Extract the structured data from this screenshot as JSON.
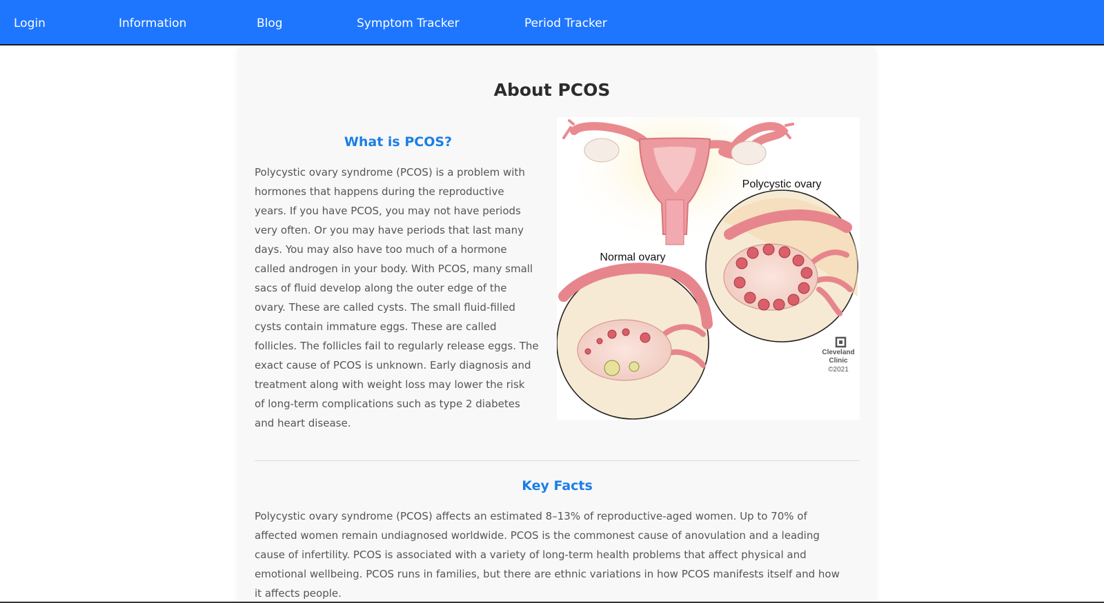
{
  "nav": {
    "items": [
      "Login",
      "Information",
      "Blog",
      "Symptom Tracker",
      "Period Tracker"
    ]
  },
  "page": {
    "title": "About PCOS"
  },
  "what_is": {
    "heading": "What is PCOS?",
    "lines": [
      "Polycystic ovary syndrome (PCOS) is a problem with",
      "hormones that happens during the reproductive",
      "years. If you have PCOS, you may not have periods",
      "very often. Or you may have periods that last many",
      "days. You may also have too much of a hormone",
      "called androgen in your body. With PCOS, many small",
      "sacs of fluid develop along the outer edge of the",
      "ovary. These are called cysts. The small fluid-filled",
      "cysts contain immature eggs. These are called",
      "follicles. The follicles fail to regularly release eggs. The",
      "exact cause of PCOS is unknown. Early diagnosis and",
      "treatment along with weight loss may lower the risk",
      "of long-term complications such as type 2 diabetes",
      "and heart disease."
    ]
  },
  "illustration": {
    "polycystic_label": "Polycystic ovary",
    "normal_label": "Normal ovary",
    "credit_line1": "Cleveland",
    "credit_line2": "Clinic",
    "credit_year": "©2021"
  },
  "key_facts": {
    "heading": "Key Facts",
    "lines": [
      "Polycystic ovary syndrome (PCOS) affects an estimated 8–13% of reproductive-aged women. Up to 70% of",
      "affected women remain undiagnosed worldwide. PCOS is the commonest cause of anovulation and a leading",
      "cause of infertility. PCOS is associated with a variety of long-term health problems that affect physical and",
      "emotional wellbeing. PCOS runs in families, but there are ethnic variations in how PCOS manifests itself and how",
      "it affects people."
    ]
  },
  "colors": {
    "nav_bg": "#1e76ff",
    "heading_blue": "#1a7ee6",
    "card_bg": "#f8f8f8"
  }
}
